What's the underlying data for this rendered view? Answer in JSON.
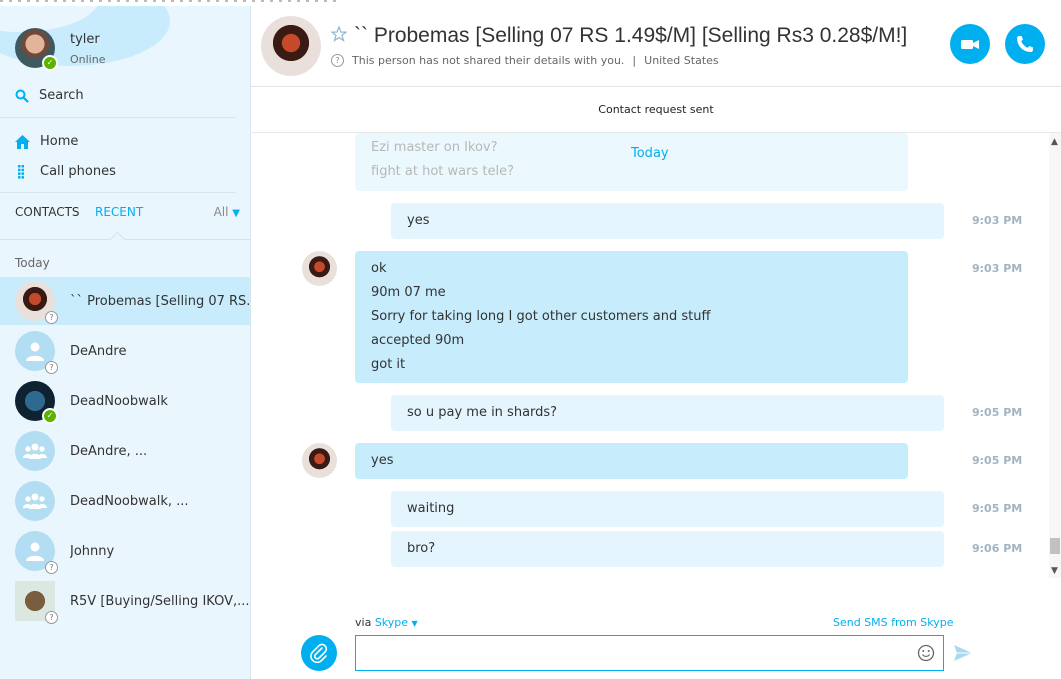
{
  "sidebar": {
    "user": {
      "name": "tyler",
      "status": "Online"
    },
    "search_label": "Search",
    "nav": {
      "home": "Home",
      "call_phones": "Call phones"
    },
    "tabs": {
      "contacts": "CONTACTS",
      "recent": "RECENT",
      "filter": "All"
    },
    "section_today": "Today",
    "contacts": [
      {
        "name": "`` Probemas [Selling 07 RS...",
        "avatar": "red-demon-avatar",
        "status": "unknown",
        "active": true
      },
      {
        "name": "DeAndre",
        "avatar": "person-icon",
        "status": "unknown"
      },
      {
        "name": "DeadNoobwalk",
        "avatar": "dark-avatar",
        "status": "online"
      },
      {
        "name": "DeAndre, ...",
        "avatar": "group-icon",
        "status": "none"
      },
      {
        "name": "DeadNoobwalk, ...",
        "avatar": "group-icon",
        "status": "none"
      },
      {
        "name": "Johnny",
        "avatar": "person-icon",
        "status": "unknown"
      },
      {
        "name": "R5V [Buying/Selling IKOV,...",
        "avatar": "rsv-avatar",
        "status": "unknown"
      }
    ]
  },
  "header": {
    "title": "`` Probemas [Selling 07 RS 1.49$/M] [Selling Rs3 0.28$/M!]",
    "info": "This person has not shared their details with you.",
    "location": "United States"
  },
  "banner": "Contact request sent",
  "chat": {
    "day_label": "Today",
    "faded_lines": [
      "Ezi master on Ikov?",
      "fight at hot wars tele?"
    ],
    "messages": [
      {
        "dir": "out",
        "lines": [
          "yes"
        ],
        "time": "9:03 PM"
      },
      {
        "dir": "in",
        "lines": [
          "ok",
          "90m 07 me",
          "Sorry for taking long I got other customers and stuff",
          "accepted 90m",
          "got it"
        ],
        "time": "9:03 PM"
      },
      {
        "dir": "out",
        "lines": [
          "so u pay me in shards?"
        ],
        "time": "9:05 PM"
      },
      {
        "dir": "in",
        "lines": [
          "yes"
        ],
        "time": "9:05 PM"
      },
      {
        "dir": "out",
        "lines": [
          "waiting"
        ],
        "time": "9:05 PM"
      },
      {
        "dir": "out",
        "lines": [
          "bro?"
        ],
        "time": "9:06 PM"
      }
    ]
  },
  "compose": {
    "via_label": "via",
    "via_service": "Skype",
    "sms_label": "Send SMS from Skype",
    "input_value": "",
    "input_placeholder": ""
  },
  "colors": {
    "accent": "#00aff0",
    "incoming_bubble": "#c7ecfc",
    "outgoing_bubble": "#e4f5fd",
    "sidebar_bg": "#eaf6fd",
    "online": "#5bb300"
  }
}
